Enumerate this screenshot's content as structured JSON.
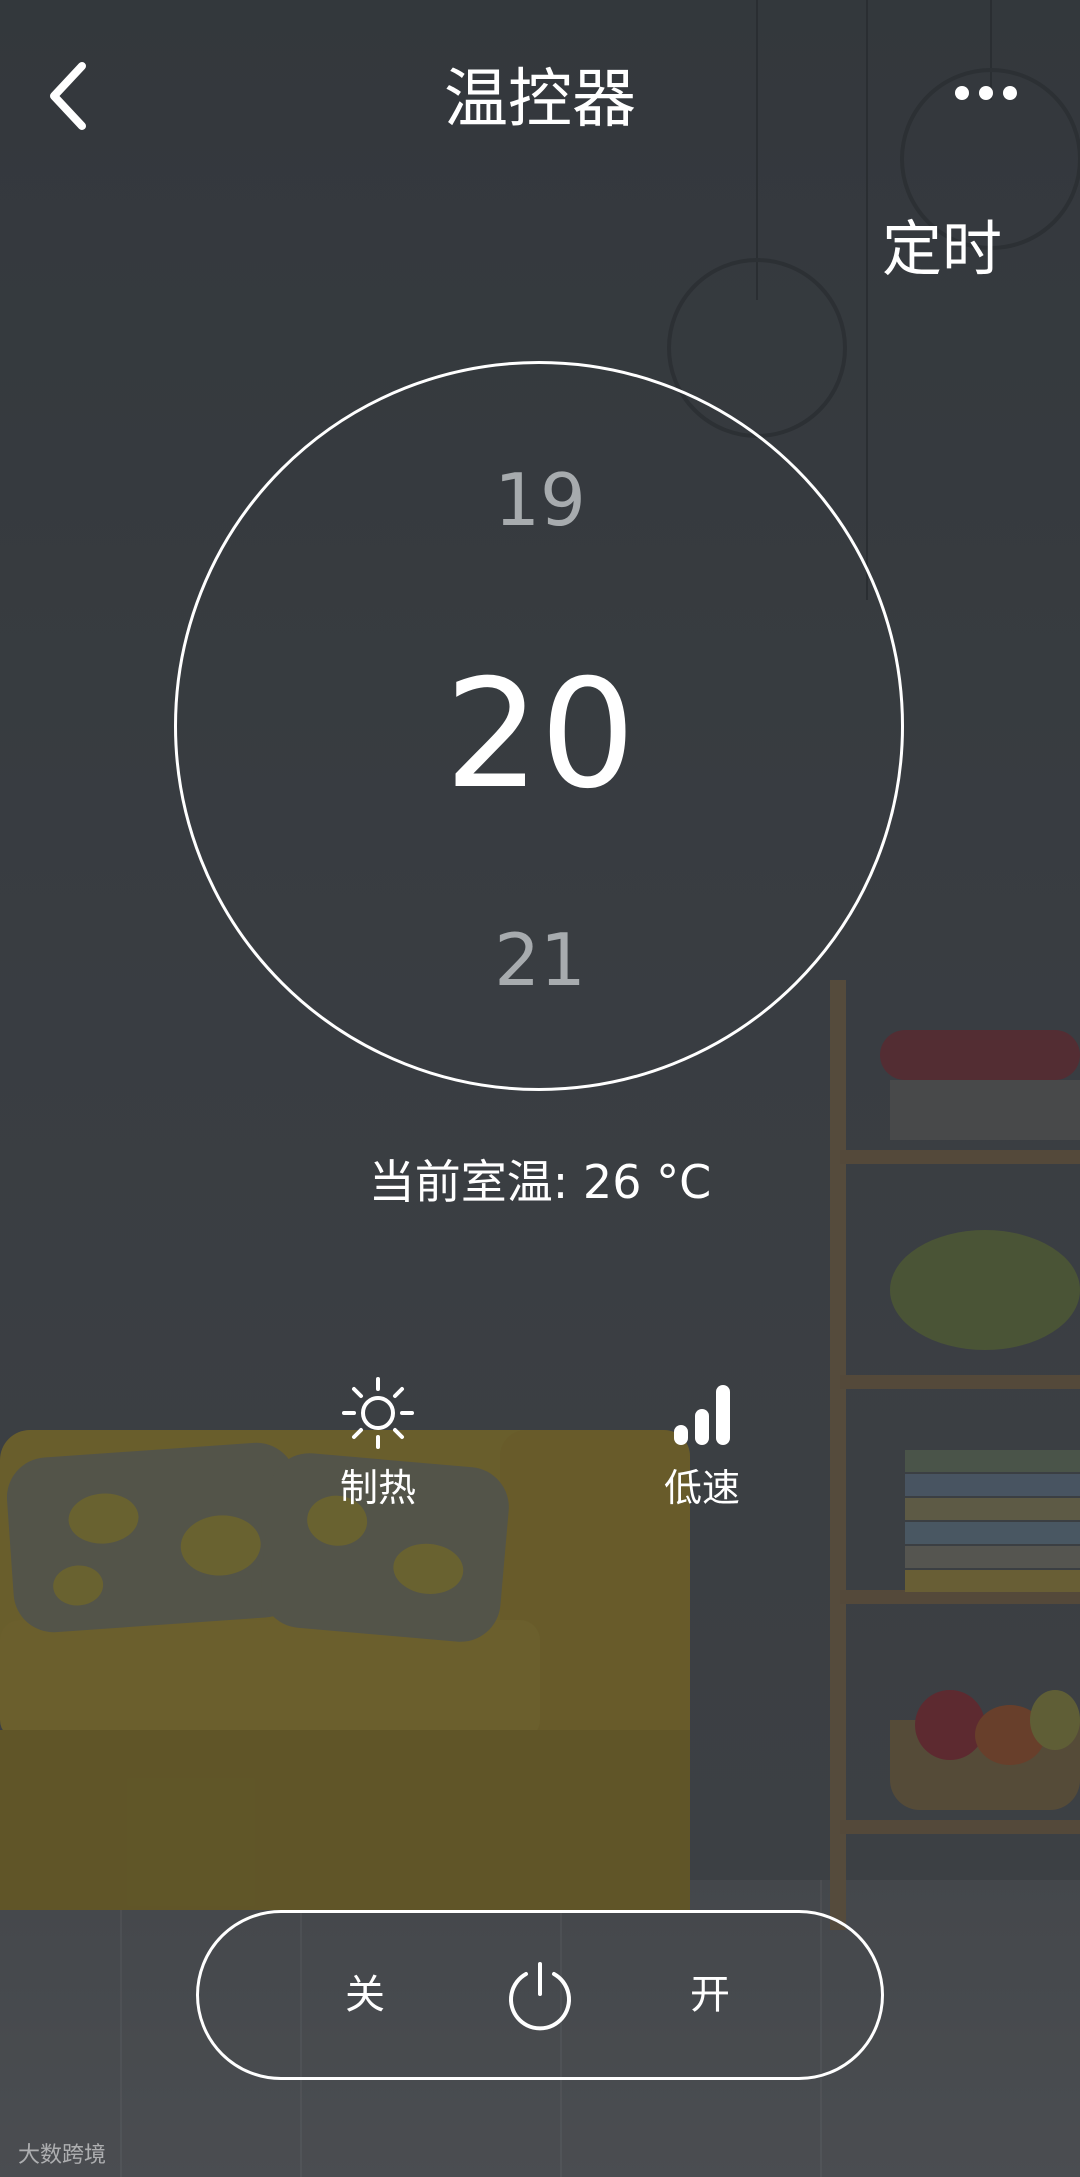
{
  "header": {
    "title": "温控器",
    "timer_label": "定时"
  },
  "dial": {
    "previous_value": "19",
    "current_value": "20",
    "next_value": "21"
  },
  "room_temperature": {
    "label": "当前室温:",
    "value": "26 °C"
  },
  "controls": {
    "mode_label": "制热",
    "fan_label": "低速"
  },
  "power": {
    "off_label": "关",
    "on_label": "开"
  },
  "watermark": {
    "text": "大数跨境"
  },
  "icons": [
    "back-chevron-icon",
    "more-dots-icon",
    "sun-icon",
    "signal-bars-icon",
    "power-icon"
  ],
  "colors": {
    "overlay": "#3d4246",
    "text": "#ffffff",
    "muted_number": "#a7abae"
  }
}
